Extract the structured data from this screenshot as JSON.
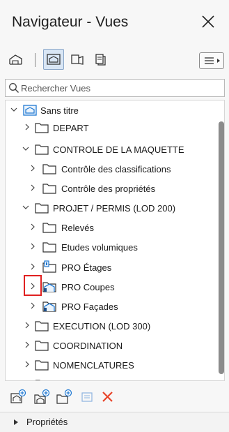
{
  "window": {
    "title": "Navigateur - Vues"
  },
  "toolbar": {
    "buttons": [
      {
        "icon": "project-map-icon",
        "selected": false
      },
      {
        "icon": "view-map-icon",
        "selected": true
      },
      {
        "icon": "layout-book-icon",
        "selected": false
      },
      {
        "icon": "publisher-sets-icon",
        "selected": false
      }
    ]
  },
  "search": {
    "placeholder": "Rechercher Vues",
    "value": ""
  },
  "tree": {
    "items": [
      {
        "label": "Sans titre",
        "level": 0,
        "expanded": true,
        "icon": "view-map-root-icon"
      },
      {
        "label": "DEPART",
        "level": 1,
        "expanded": false,
        "icon": "folder-icon"
      },
      {
        "label": "CONTROLE DE LA MAQUETTE",
        "level": 1,
        "expanded": true,
        "icon": "folder-icon"
      },
      {
        "label": "Contrôle des classifications",
        "level": 2,
        "expanded": false,
        "icon": "folder-icon"
      },
      {
        "label": "Contrôle des propriétés",
        "level": 2,
        "expanded": false,
        "icon": "folder-icon"
      },
      {
        "label": "PROJET / PERMIS (LOD 200)",
        "level": 1,
        "expanded": true,
        "icon": "folder-icon"
      },
      {
        "label": "Relevés",
        "level": 2,
        "expanded": false,
        "icon": "folder-icon"
      },
      {
        "label": "Etudes volumiques",
        "level": 2,
        "expanded": false,
        "icon": "folder-icon"
      },
      {
        "label": "PRO Étages",
        "level": 2,
        "expanded": false,
        "icon": "story-folder-icon"
      },
      {
        "label": "PRO Coupes",
        "level": 2,
        "expanded": false,
        "icon": "section-folder-icon",
        "highlighted": true
      },
      {
        "label": "PRO Façades",
        "level": 2,
        "expanded": false,
        "icon": "elevation-folder-icon"
      },
      {
        "label": "EXECUTION (LOD 300)",
        "level": 1,
        "expanded": false,
        "icon": "folder-icon"
      },
      {
        "label": "COORDINATION",
        "level": 1,
        "expanded": false,
        "icon": "folder-icon"
      },
      {
        "label": "NOMENCLATURES",
        "level": 1,
        "expanded": false,
        "icon": "folder-icon"
      }
    ]
  },
  "bottom_toolbar": {
    "buttons": [
      "new-view-icon",
      "clone-folder-icon",
      "new-folder-icon",
      "settings-icon",
      "delete-icon"
    ]
  },
  "properties": {
    "label": "Propriétés"
  },
  "colors": {
    "accent": "#1e78d2",
    "highlight": "#e02020",
    "delete": "#e8442a"
  }
}
